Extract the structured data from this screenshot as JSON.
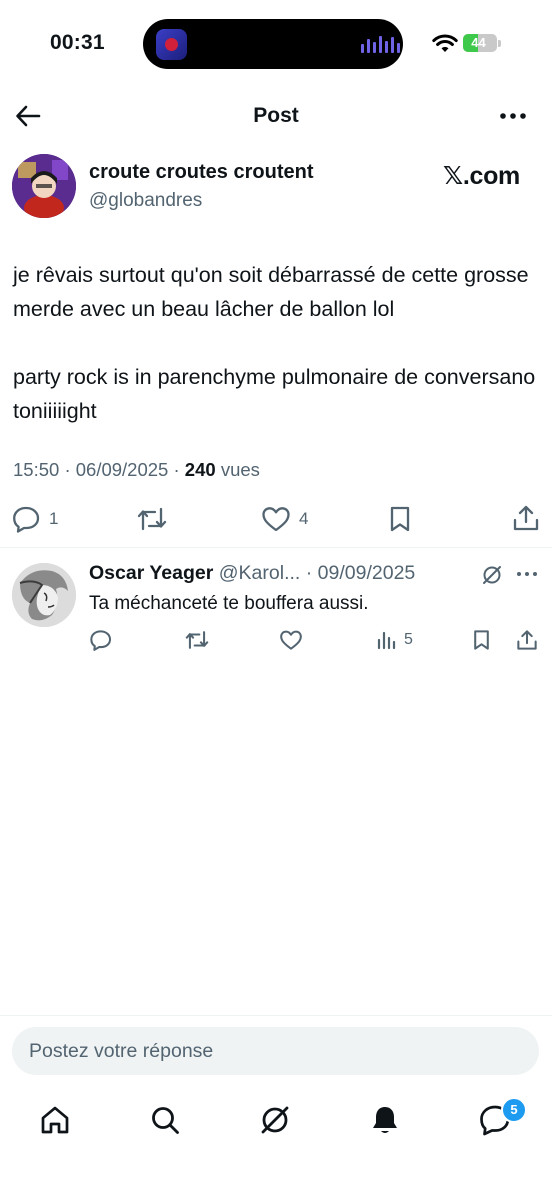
{
  "status_bar": {
    "time": "00:31",
    "battery_text": "44",
    "battery_level_percent": 44,
    "icons": [
      "now-playing-app-icon",
      "audio-waveform-icon",
      "wifi-icon",
      "battery-icon"
    ]
  },
  "header": {
    "title": "Post",
    "icons": [
      "back-arrow-icon",
      "more-options-icon"
    ]
  },
  "post": {
    "author_name": "croute croutes croutent",
    "author_handle": "@globandres",
    "watermark": "𝕏.com",
    "text": "je rêvais surtout qu'on soit débarrassé de cette grosse merde avec un beau lâcher de ballon lol\n\nparty rock is in parenchyme pulmonaire de conversano toniiiiight",
    "time": "15:50",
    "date": "06/09/2025",
    "views": "240",
    "views_label": "vues",
    "actions": {
      "reply_count": "1",
      "retweet_count": "",
      "like_count": "4"
    }
  },
  "reply": {
    "author_name": "Oscar Yeager",
    "author_handle": "@Karol...",
    "separator": "·",
    "date": "09/09/2025",
    "text": "Ta méchanceté te bouffera aussi.",
    "views_count": "5"
  },
  "compose": {
    "placeholder": "Postez votre réponse"
  },
  "bottom_nav": {
    "items": [
      "home-icon",
      "search-icon",
      "grok-icon",
      "notifications-icon",
      "messages-icon"
    ],
    "messages_badge": "5"
  },
  "colors": {
    "text_primary": "#0f1419",
    "text_secondary": "#536471",
    "accent": "#1d9bf0",
    "divider": "#eff3f4",
    "battery": "#3ec94b"
  }
}
